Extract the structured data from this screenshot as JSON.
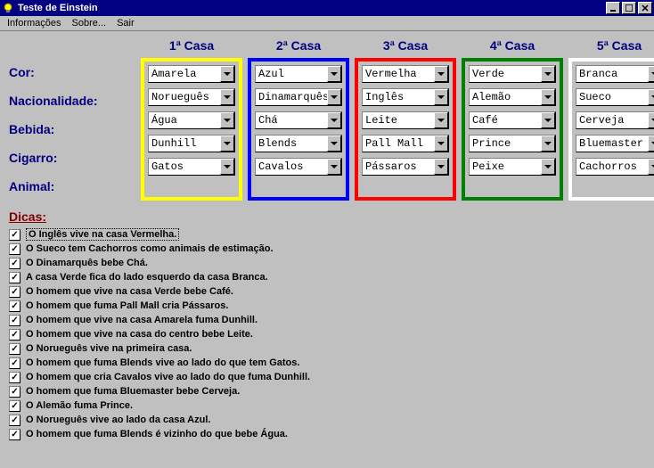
{
  "window": {
    "title": "Teste de Einstein"
  },
  "menu": {
    "info": "Informações",
    "about": "Sobre...",
    "exit": "Sair"
  },
  "headers": {
    "h1": "1ª Casa",
    "h2": "2ª Casa",
    "h3": "3ª Casa",
    "h4": "4ª Casa",
    "h5": "5ª Casa"
  },
  "rows": {
    "cor": "Cor:",
    "nac": "Nacionalidade:",
    "beb": "Bebida:",
    "cig": "Cigarro:",
    "ani": "Animal:"
  },
  "houses": {
    "1": {
      "cor": "Amarela",
      "nac": "Norueguês",
      "beb": "Água",
      "cig": "Dunhill",
      "ani": "Gatos"
    },
    "2": {
      "cor": "Azul",
      "nac": "Dinamarquês",
      "beb": "Chá",
      "cig": "Blends",
      "ani": "Cavalos"
    },
    "3": {
      "cor": "Vermelha",
      "nac": "Inglês",
      "beb": "Leite",
      "cig": "Pall Mall",
      "ani": "Pássaros"
    },
    "4": {
      "cor": "Verde",
      "nac": "Alemão",
      "beb": "Café",
      "cig": "Prince",
      "ani": "Peixe"
    },
    "5": {
      "cor": "Branca",
      "nac": "Sueco",
      "beb": "Cerveja",
      "cig": "Bluemaster",
      "ani": "Cachorros"
    }
  },
  "dicas_title": "Dicas:",
  "hints": [
    "O Inglês vive na casa Vermelha.",
    "O Sueco tem Cachorros como animais de estimação.",
    "O Dinamarquês bebe Chá.",
    "A casa Verde fica do lado esquerdo da casa Branca.",
    "O homem que vive na casa Verde bebe Café.",
    "O homem que fuma Pall Mall cria Pássaros.",
    "O homem que vive na casa Amarela fuma Dunhill.",
    "O homem que vive na casa do centro bebe Leite.",
    "O Norueguês vive na primeira casa.",
    "O homem que fuma Blends vive ao lado do que tem Gatos.",
    "O homem que cria Cavalos vive ao lado do que fuma Dunhill.",
    "O homem que fuma Bluemaster bebe Cerveja.",
    "O Alemão fuma Prince.",
    "O Norueguês vive ao lado da casa Azul.",
    "O homem que fuma Blends é vizinho do que bebe Água."
  ]
}
